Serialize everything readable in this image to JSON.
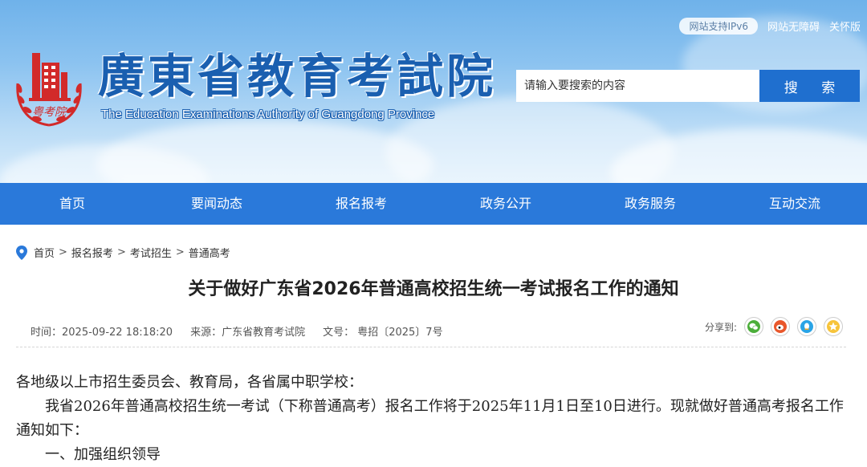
{
  "header": {
    "title": "廣東省教育考試院",
    "subtitle": "The Education Examinations Authority of Guangdong Province",
    "emblem_text": "粤考院",
    "ipv6_badge": "网站支持IPv6",
    "links": [
      "网站无障碍",
      "关怀版"
    ],
    "search": {
      "placeholder": "请输入要搜索的内容",
      "button_label": "搜 索"
    }
  },
  "nav": {
    "items": [
      "首页",
      "要闻动态",
      "报名报考",
      "政务公开",
      "政务服务",
      "互动交流"
    ]
  },
  "breadcrumb": [
    "首页",
    "报名报考",
    "考试招生",
    "普通高考"
  ],
  "breadcrumb_sep": ">",
  "article": {
    "title": "关于做好广东省2026年普通高校招生统一考试报名工作的通知",
    "meta": {
      "time": "时间：2025-09-22 18:18:20",
      "source": "来源：广东省教育考试院",
      "doc_no": "文号： 粤招〔2025〕7号"
    },
    "share_label": "分享到:",
    "share_icons": [
      "wechat-icon",
      "weibo-icon",
      "qq-icon",
      "qzone-icon"
    ],
    "body": {
      "greeting": "各地级以上市招生委员会、教育局，各省属中职学校：",
      "para1": "我省2026年普通高校招生统一考试（下称普通高考）报名工作将于2025年11月1日至10日进行。现就做好普通高考报名工作通知如下：",
      "section1": "一、加强组织领导"
    }
  },
  "colors": {
    "nav_bg": "#2a79da",
    "search_button": "#1f6fcf",
    "title_blue": "#1a5fb0",
    "emblem_red": "#d22a2a"
  }
}
